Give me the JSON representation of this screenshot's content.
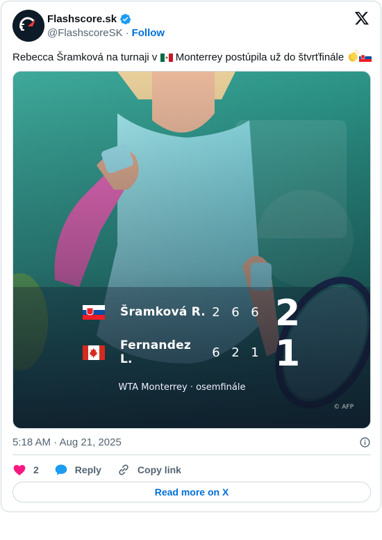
{
  "account": {
    "display_name": "Flashscore.sk",
    "handle": "@FlashscoreSK",
    "separator": "·",
    "follow_label": "Follow"
  },
  "tweet": {
    "text_part1": "Rebecca Šramková na turnaji v ",
    "text_part2": " Monterrey postúpila už do štvrťfinále ",
    "timestamp": "5:18 AM · Aug 21, 2025"
  },
  "scoreboard": {
    "players": [
      {
        "name": "Šramková R.",
        "flag": "slovakia-flag",
        "sets": [
          "2",
          "6",
          "6"
        ],
        "total": "2"
      },
      {
        "name": "Fernandez L.",
        "flag": "canada-flag",
        "sets": [
          "6",
          "2",
          "1"
        ],
        "total": "1"
      }
    ],
    "event": "WTA Monterrey · osemfinále",
    "credit": "© AFP"
  },
  "actions": {
    "likes_count": "2",
    "reply_label": "Reply",
    "copy_link_label": "Copy link"
  },
  "read_more_label": "Read more on X",
  "colors": {
    "link_blue": "#006fd6",
    "like_pink": "#f91880",
    "reply_blue": "#1d9bf0",
    "secondary_text": "#536471",
    "border": "#cfd9de"
  }
}
